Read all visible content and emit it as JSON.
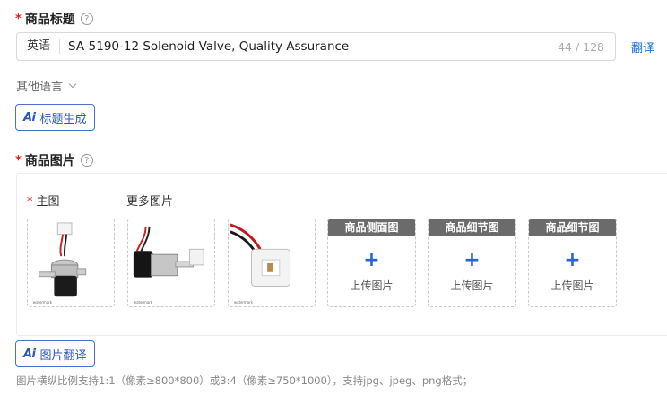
{
  "title_section": {
    "required_mark": "*",
    "label": "商品标题",
    "help_icon": "question-circle-icon",
    "language": "英语",
    "value": "SA-5190-12 Solenoid Valve, Quality Assurance",
    "counter": "44 / 128",
    "translate_label": "翻译",
    "other_languages_label": "其他语言",
    "ai_generate_label": "标题生成",
    "ai_badge": "Ai"
  },
  "image_section": {
    "required_mark": "*",
    "label": "商品图片",
    "help_icon": "question-circle-icon",
    "main_image_label": "主图",
    "more_images_label": "更多图片",
    "images": [
      {
        "name": "main-image"
      },
      {
        "name": "more-image-1"
      },
      {
        "name": "more-image-2"
      }
    ],
    "upload_slots": [
      {
        "header": "商品侧面图",
        "plus": "+",
        "label": "上传图片"
      },
      {
        "header": "商品细节图",
        "plus": "+",
        "label": "上传图片"
      },
      {
        "header": "商品细节图",
        "plus": "+",
        "label": "上传图片"
      }
    ],
    "ai_translate_label": "图片翻译",
    "ai_badge": "Ai",
    "hint": "图片横纵比例支持1:1（像素≥800*800）或3:4（像素≥750*1000），支持jpg、jpeg、png格式；"
  },
  "colors": {
    "accent": "#1f6fd6",
    "required": "#e02020",
    "slot_header": "#6b6b6b"
  }
}
